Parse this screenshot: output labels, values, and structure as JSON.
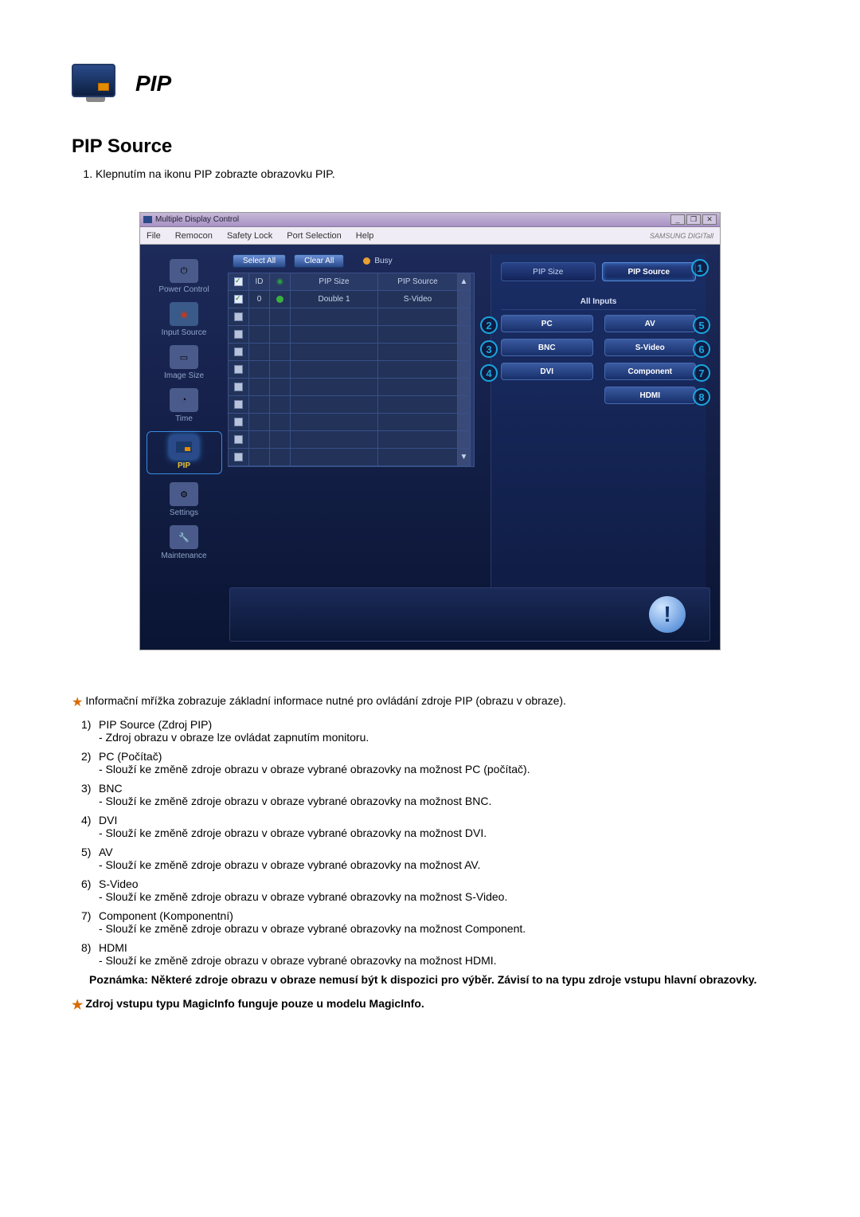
{
  "header": {
    "pip_label": "PIP"
  },
  "section": {
    "title": "PIP Source"
  },
  "intro": {
    "item1": "Klepnutím na ikonu PIP zobrazte obrazovku PIP."
  },
  "shot": {
    "titlebar": "Multiple Display Control",
    "winbtns": {
      "min": "_",
      "max": "❐",
      "close": "✕"
    },
    "menu": {
      "file": "File",
      "remocon": "Remocon",
      "safety": "Safety Lock",
      "port": "Port Selection",
      "help": "Help"
    },
    "brand": "SAMSUNG DIGITall",
    "sidebar": {
      "power": "Power Control",
      "input": "Input Source",
      "image": "Image Size",
      "time": "Time",
      "pip": "PIP",
      "settings": "Settings",
      "maint": "Maintenance"
    },
    "toolbar": {
      "select_all": "Select All",
      "clear_all": "Clear All",
      "busy": "Busy"
    },
    "grid": {
      "headers": {
        "id": "ID",
        "pipsize": "PIP Size",
        "pipsrc": "PIP Source"
      },
      "row1": {
        "id": "0",
        "pipsize": "Double 1",
        "pipsrc": "S-Video"
      }
    },
    "right": {
      "tab_pipsize": "PIP Size",
      "tab_pipsource": "PIP Source",
      "all_inputs": "All Inputs",
      "pc": "PC",
      "av": "AV",
      "bnc": "BNC",
      "svideo": "S-Video",
      "dvi": "DVI",
      "component": "Component",
      "hdmi": "HDMI"
    },
    "callouts": {
      "c1": "1",
      "c2": "2",
      "c3": "3",
      "c4": "4",
      "c5": "5",
      "c6": "6",
      "c7": "7",
      "c8": "8"
    }
  },
  "lead_note": "Informační mřížka zobrazuje základní informace nutné pro ovládání zdroje PIP (obrazu v obraze).",
  "notes": [
    {
      "n": "1)",
      "t": "PIP Source (Zdroj PIP)",
      "d": "- Zdroj obrazu v obraze lze ovládat zapnutím monitoru."
    },
    {
      "n": "2)",
      "t": "PC (Počítač)",
      "d": "- Slouží ke změně zdroje obrazu v obraze vybrané obrazovky na možnost PC (počítač)."
    },
    {
      "n": "3)",
      "t": "BNC",
      "d": "- Slouží ke změně zdroje obrazu v obraze vybrané obrazovky na možnost BNC."
    },
    {
      "n": "4)",
      "t": "DVI",
      "d": "- Slouží ke změně zdroje obrazu v obraze vybrané obrazovky na možnost DVI."
    },
    {
      "n": "5)",
      "t": "AV",
      "d": "- Slouží ke změně zdroje obrazu v obraze vybrané obrazovky na možnost AV."
    },
    {
      "n": "6)",
      "t": "S-Video",
      "d": "- Slouží ke změně zdroje obrazu v obraze vybrané obrazovky na možnost S-Video."
    },
    {
      "n": "7)",
      "t": "Component (Komponentní)",
      "d": "- Slouží ke změně zdroje obrazu v obraze vybrané obrazovky na možnost Component."
    },
    {
      "n": "8)",
      "t": "HDMI",
      "d": "- Slouží ke změně zdroje obrazu v obraze vybrané obrazovky na možnost HDMI."
    }
  ],
  "footnote": "Poznámka: Některé zdroje obrazu v obraze nemusí být k dispozici pro výběr. Závisí to na typu zdroje vstupu hlavní obrazovky.",
  "magic_note": "Zdroj vstupu typu MagicInfo funguje pouze u modelu MagicInfo."
}
